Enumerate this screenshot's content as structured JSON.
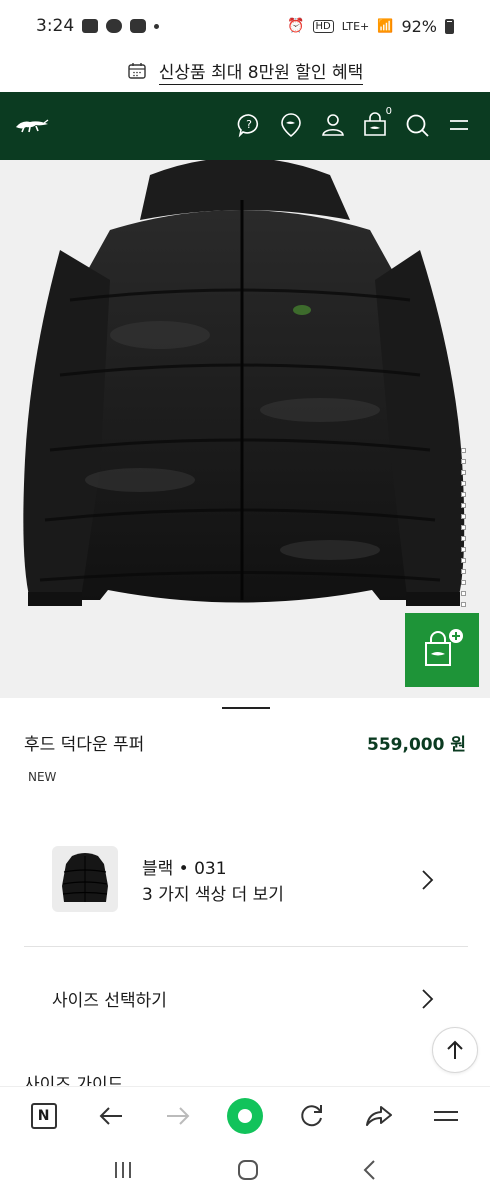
{
  "status_bar": {
    "time": "3:24",
    "battery": "92%",
    "network": "LTE+"
  },
  "promo": {
    "text": "신상품 최대 8만원 할인 혜택",
    "icon": "calendar-icon"
  },
  "header": {
    "brand_icon": "crocodile-logo-icon",
    "icons": [
      "help-icon",
      "store-locator-icon",
      "account-icon",
      "cart-icon",
      "search-icon",
      "menu-icon"
    ],
    "cart_count": "0",
    "background": "#0b3b21"
  },
  "product": {
    "name": "후드 덕다운 푸퍼",
    "price": "559,000 원",
    "badge": "NEW",
    "accent_color": "#1e9438"
  },
  "color_option": {
    "name": "블랙 • 031",
    "more": "3 가지 색상 더 보기"
  },
  "size": {
    "label": "사이즈 선택하기"
  },
  "size_guide": {
    "label": "사이즈 가이드"
  },
  "browser_bar": {
    "icons": [
      "naver-n-icon",
      "back-arrow-icon",
      "forward-arrow-icon",
      "home-icon",
      "refresh-icon",
      "share-icon",
      "menu-icon"
    ],
    "n_label": "N"
  }
}
